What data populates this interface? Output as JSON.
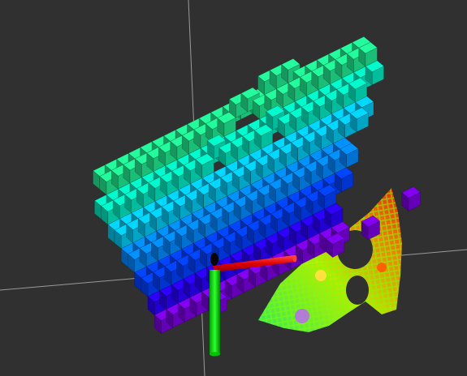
{
  "viewport": {
    "background": "#303030",
    "grid_color": "#a0a0a0"
  },
  "voxel_map": {
    "color_mode": "height-rainbow",
    "height_colors": [
      "#7a00e0",
      "#2a00ff",
      "#0040ff",
      "#0088ff",
      "#00c8f0",
      "#00e8c0",
      "#20e890"
    ],
    "levels": 7
  },
  "point_cloud": {
    "color_mode": "height-rainbow",
    "colors": [
      "#ff2000",
      "#ff8000",
      "#ffe000",
      "#a0ff00",
      "#30ff60",
      "#00c0ff",
      "#c040ff"
    ]
  },
  "axes": {
    "x_color": "#ff0000",
    "y_color": "#00ff00",
    "z_color": "#0000ff",
    "origin_color": "#000000"
  }
}
